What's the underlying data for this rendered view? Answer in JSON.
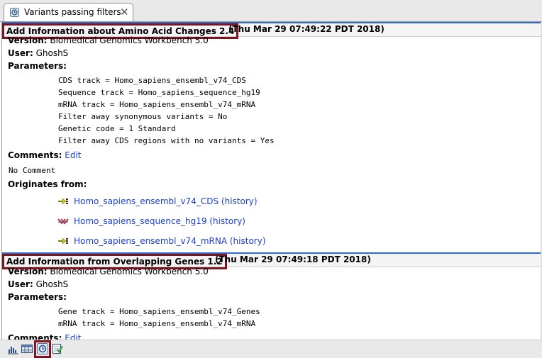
{
  "tab": {
    "title": "Variants passing filters",
    "icon": "history-icon",
    "close": "✕"
  },
  "entries": [
    {
      "name": "Add Information about Amino Acid Changes 2.4",
      "date": "(Thu Mar 29 07:49:22 PDT 2018)",
      "version_label": "Version:",
      "version": "Biomedical Genomics Workbench 5.0",
      "user_label": "User:",
      "user": "GhoshS",
      "parameters_label": "Parameters:",
      "parameters": [
        "CDS track = Homo_sapiens_ensembl_v74_CDS",
        "Sequence track = Homo_sapiens_sequence_hg19",
        "mRNA track = Homo_sapiens_ensembl_v74_mRNA",
        "Filter away synonymous variants = No",
        "Genetic code = 1 Standard",
        "Filter away CDS regions with no variants = Yes"
      ],
      "comments_label": "Comments:",
      "edit_label": "Edit",
      "comment": "No Comment",
      "originates_label": "Originates from:",
      "origins": [
        {
          "name": "Homo_sapiens_ensembl_v74_CDS",
          "history": "(history)",
          "icon": "cds-track-icon"
        },
        {
          "name": "Homo_sapiens_sequence_hg19",
          "history": "(history)",
          "icon": "sequence-track-icon"
        },
        {
          "name": "Homo_sapiens_ensembl_v74_mRNA",
          "history": "(history)",
          "icon": "mrna-track-icon"
        }
      ]
    },
    {
      "name": "Add Information from Overlapping Genes 1.2",
      "date": "(Thu Mar 29 07:49:18 PDT 2018)",
      "version_label": "Version:",
      "version": "Biomedical Genomics Workbench 5.0",
      "user_label": "User:",
      "user": "GhoshS",
      "parameters_label": "Parameters:",
      "parameters": [
        "Gene track = Homo_sapiens_ensembl_v74_Genes",
        "mRNA track = Homo_sapiens_ensembl_v74_mRNA"
      ],
      "comments_label": "Comments:",
      "edit_label": "Edit"
    }
  ],
  "footer": {
    "buttons": [
      {
        "icon": "graph-view-icon"
      },
      {
        "icon": "table-view-icon"
      },
      {
        "icon": "history-view-icon",
        "selected": true
      },
      {
        "icon": "filter-view-icon"
      }
    ]
  },
  "colors": {
    "highlight_box": "#7d1420",
    "link": "#1a3fd0",
    "header_rule": "#2f6bd1"
  }
}
